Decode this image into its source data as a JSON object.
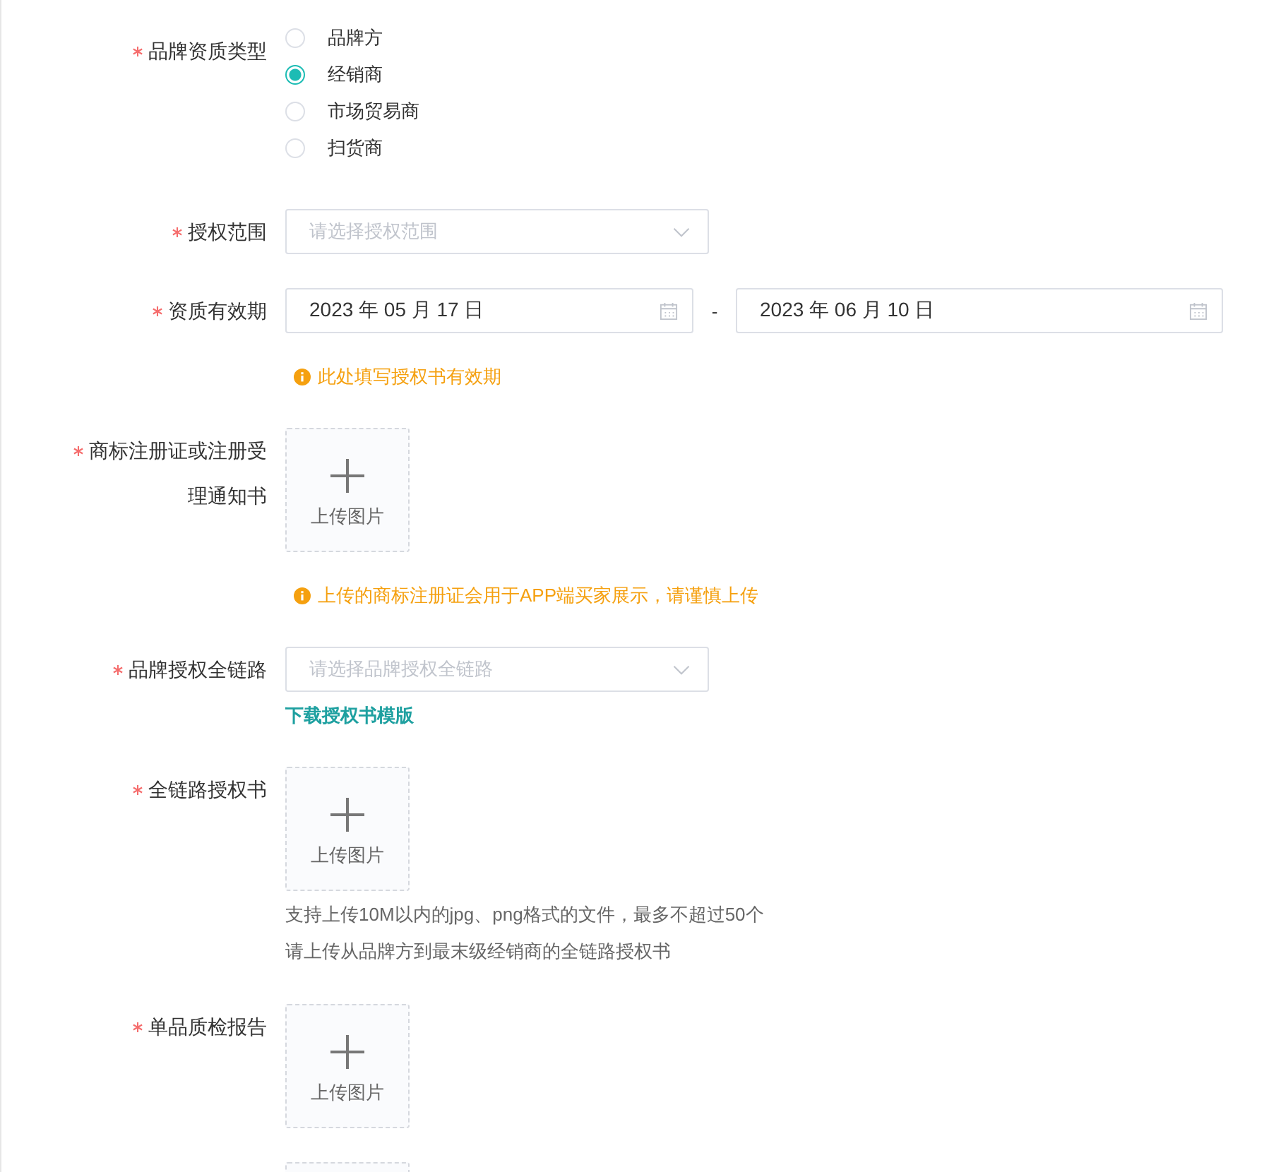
{
  "fields": [
    {
      "kind": "radio",
      "label": "品牌资质类型",
      "required": true,
      "options": [
        {
          "label": "品牌方",
          "selected": false
        },
        {
          "label": "经销商",
          "selected": true
        },
        {
          "label": "市场贸易商",
          "selected": false
        },
        {
          "label": "扫货商",
          "selected": false
        }
      ]
    },
    {
      "kind": "select",
      "label": "授权范围",
      "required": true,
      "placeholder": "请选择授权范围"
    },
    {
      "kind": "date_range",
      "label": "资质有效期",
      "required": true,
      "start": "2023 年 05 月 17 日",
      "separator": "-",
      "end": "2023 年 06 月 10 日",
      "notice": "此处填写授权书有效期"
    },
    {
      "kind": "upload",
      "label": "商标注册证或注册受理通知书",
      "required": true,
      "button": "上传图片",
      "notice": "上传的商标注册证会用于APP端买家展示，请谨慎上传"
    },
    {
      "kind": "select",
      "label": "品牌授权全链路",
      "required": true,
      "placeholder": "请选择品牌授权全链路",
      "link": "下载授权书模版"
    },
    {
      "kind": "upload",
      "label": "全链路授权书",
      "required": true,
      "button": "上传图片",
      "help": [
        "支持上传10M以内的jpg、png格式的文件，最多不超过50个",
        "请上传从品牌方到最末级经销商的全链路授权书"
      ]
    },
    {
      "kind": "upload",
      "label": "单品质检报告",
      "required": true,
      "button": "上传图片"
    },
    {
      "kind": "upload",
      "required": false
    }
  ]
}
